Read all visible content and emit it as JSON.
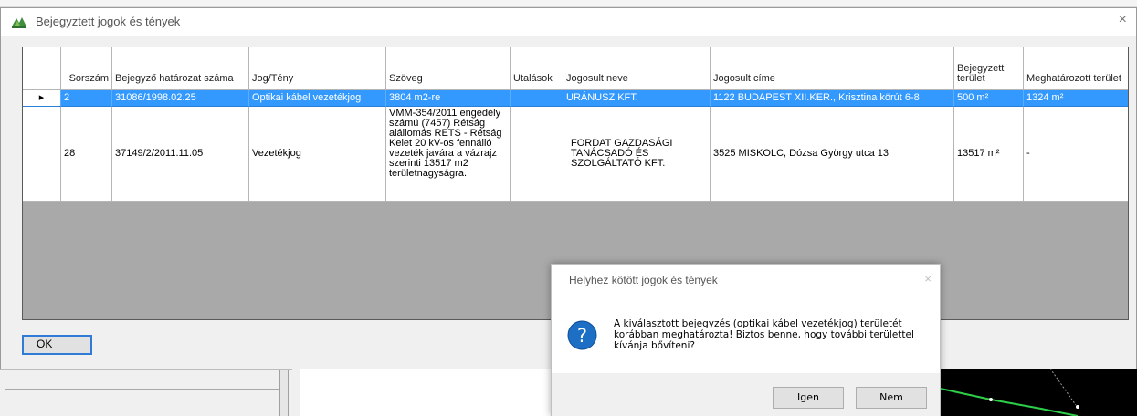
{
  "main_window": {
    "title": "Bejegyztett jogok és tények",
    "close_glyph": "×",
    "ok_label": "OK"
  },
  "grid": {
    "headers": {
      "sorszam": "Sorszám",
      "hatarozat": "Bejegyző határozat száma",
      "jog": "Jog/Tény",
      "szoveg": "Szöveg",
      "utalasok": "Utalások",
      "jogosult_neve": "Jogosult neve",
      "jogosult_cime": "Jogosult címe",
      "bejegyzett_terulet": "Bejegyzett terület",
      "meghatarozott_terulet": "Meghatározott terület"
    },
    "rows": [
      {
        "marker": "▸",
        "sorszam": "2",
        "hatarozat": "31086/1998.02.25",
        "jog": "Optikai kábel vezetékjog",
        "szoveg": "3804 m2-re",
        "utalasok": "",
        "jogosult_neve": "URÁNUSZ KFT.",
        "jogosult_cime": "1122 BUDAPEST XII.KER., Krisztina körút 6-8",
        "bejegyzett_terulet": "500 m²",
        "meghatarozott_terulet": "1324 m²"
      },
      {
        "marker": "",
        "sorszam": "28",
        "hatarozat": "37149/2/2011.11.05",
        "jog": "Vezetékjog",
        "szoveg": "VMM-354/2011 engedély számú (7457) Rétság alállomás RETS - Rétság Kelet 20 kV-os fennálló vezeték javára a vázrajz szerinti 13517 m2 területnagyságra.",
        "utalasok": "",
        "jogosult_neve": "FORDAT GAZDASÁGI TANÁCSADÓ ÉS SZOLGÁLTATÓ KFT.",
        "jogosult_cime": "3525 MISKOLC, Dózsa György utca 13",
        "bejegyzett_terulet": "13517 m²",
        "meghatarozott_terulet": "-"
      }
    ]
  },
  "dialog": {
    "title": "Helyhez kötött jogok és tények",
    "close_glyph": "×",
    "message": "A kiválasztott bejegyzés (optikai kábel vezetékjog) területét korábban meghatározta! Biztos benne, hogy további területtel kívánja bővíteni?",
    "yes_label": "Igen",
    "no_label": "Nem"
  },
  "colors": {
    "selection": "#3399ff",
    "grid_background": "#a9a9a9",
    "question_icon": "#1c6fc4",
    "ok_border": "#2f7bd6"
  },
  "icons": {
    "app": "app-logo-icon",
    "question": "question-icon",
    "row_marker": "row-pointer-icon"
  }
}
